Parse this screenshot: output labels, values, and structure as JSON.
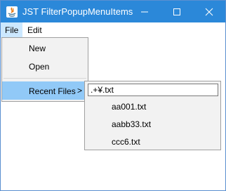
{
  "window": {
    "title": "JST FilterPopupMenuItems",
    "accent": "#2b88d9"
  },
  "titlebar_buttons": {
    "minimize_icon": "minimize-icon",
    "maximize_icon": "maximize-icon",
    "close_icon": "close-icon"
  },
  "menubar": {
    "items": [
      {
        "label": "File",
        "selected": true
      },
      {
        "label": "Edit",
        "selected": false
      }
    ]
  },
  "file_menu": {
    "items": [
      {
        "label": "New"
      },
      {
        "label": "Open"
      },
      {
        "label": "Recent Files",
        "has_submenu": true,
        "submenu_arrow": ">"
      }
    ]
  },
  "recent_files": {
    "filter_value": ".+¥.txt",
    "items": [
      {
        "label": "aa001.txt"
      },
      {
        "label": "aabb33.txt"
      },
      {
        "label": "ccc6.txt"
      }
    ]
  }
}
